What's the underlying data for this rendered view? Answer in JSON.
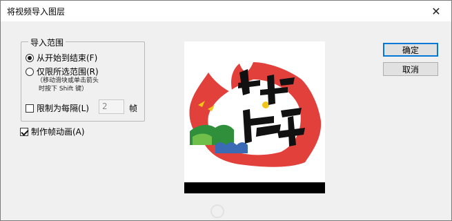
{
  "window": {
    "title": "将视频导入图层",
    "close_glyph": "✕"
  },
  "import_range": {
    "legend": "导入范围",
    "option_all": "从开始到结束(F)",
    "option_selected": "仅限所选范围(R)",
    "hint_line1": "（移动滑块或单击箭头",
    "hint_line2": "时按下 Shift 键）",
    "limit_label": "限制为每隔(L)",
    "limit_value": "2",
    "limit_unit": "帧",
    "limit_checked": false,
    "selected_option": "all"
  },
  "make_animation": {
    "label": "制作帧动画(A)",
    "checked": true
  },
  "buttons": {
    "ok": "确定",
    "cancel": "取消"
  },
  "preview": {
    "icon": "video-frame-preview"
  },
  "colors": {
    "accent": "#0078d7",
    "flame": "#e0302a",
    "ink": "#111111"
  }
}
